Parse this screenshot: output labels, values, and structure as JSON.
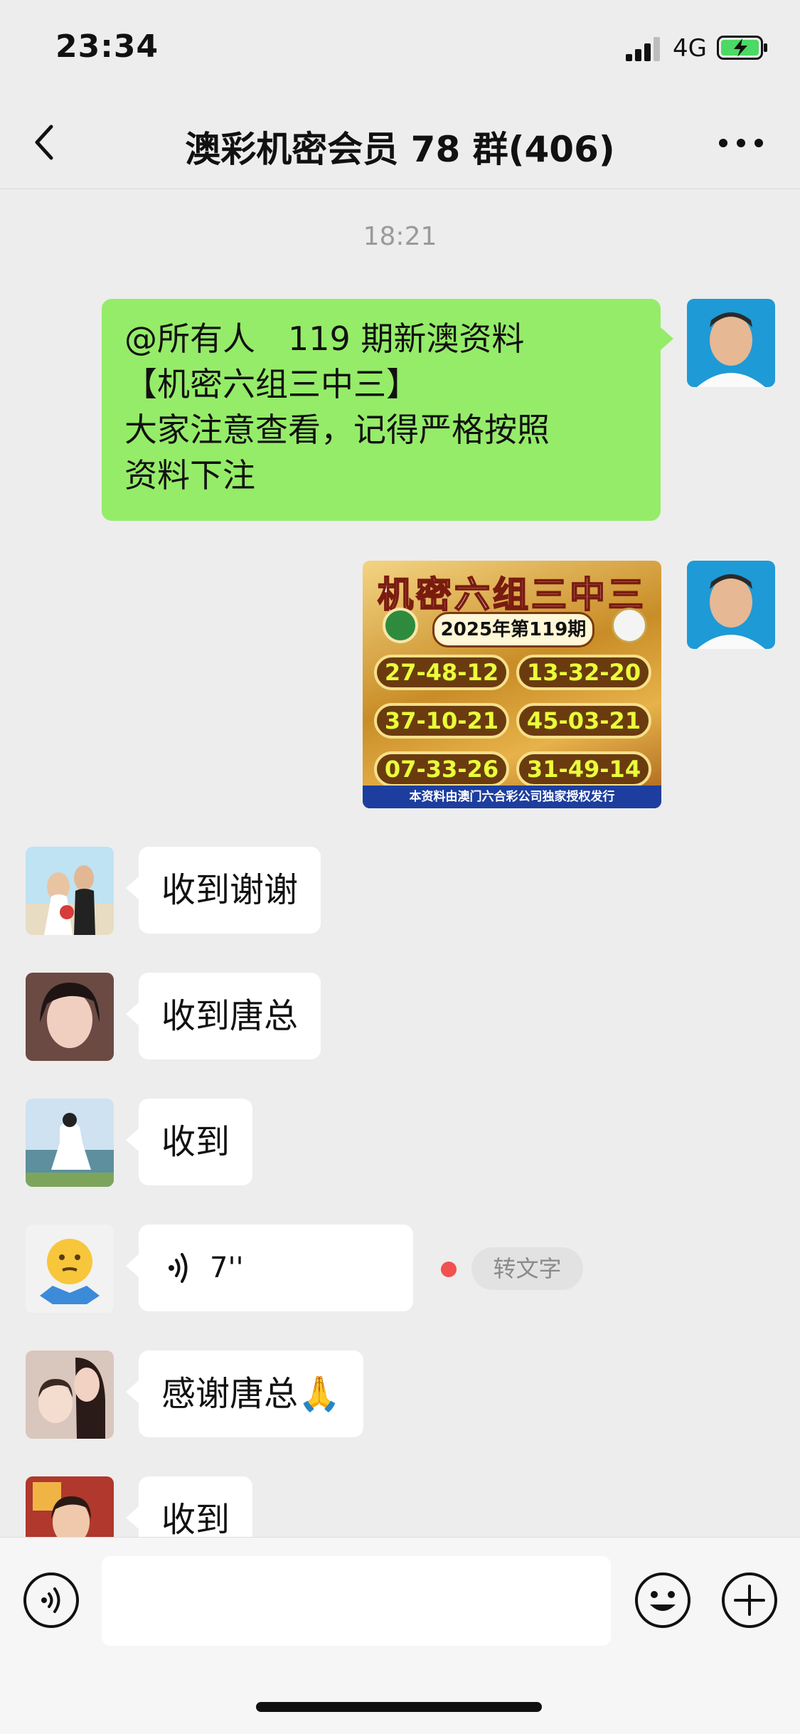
{
  "status_bar": {
    "time": "23:34",
    "network": "4G"
  },
  "header": {
    "title": "澳彩机密会员 78 群(406)"
  },
  "timestamp": "18:21",
  "messages": {
    "text_out": {
      "lines": [
        "@所有人　119 期新澳资料",
        "【机密六组三中三】",
        "大家注意查看，记得严格按照",
        "资料下注"
      ]
    },
    "image_out": {
      "title": "机密六组三中三",
      "year_label": "2025年第119期",
      "numbers": [
        "27-48-12",
        "13-32-20",
        "37-10-21",
        "45-03-21",
        "07-33-26",
        "31-49-14"
      ],
      "footer": "本资料由澳门六合彩公司独家授权发行"
    },
    "in_1": "收到谢谢",
    "in_2": "收到唐总",
    "in_3": "收到",
    "voice": {
      "duration": "7''",
      "to_text": "转文字"
    },
    "in_5": "感谢唐总🙏",
    "in_6": "收到"
  },
  "colors": {
    "outgoing_bubble": "#95ec69",
    "background": "#ededed",
    "unread_dot": "#f25151"
  },
  "icons": [
    "back-arrow-icon",
    "more-icon",
    "voice-mode-icon",
    "emoji-icon",
    "plus-icon"
  ]
}
